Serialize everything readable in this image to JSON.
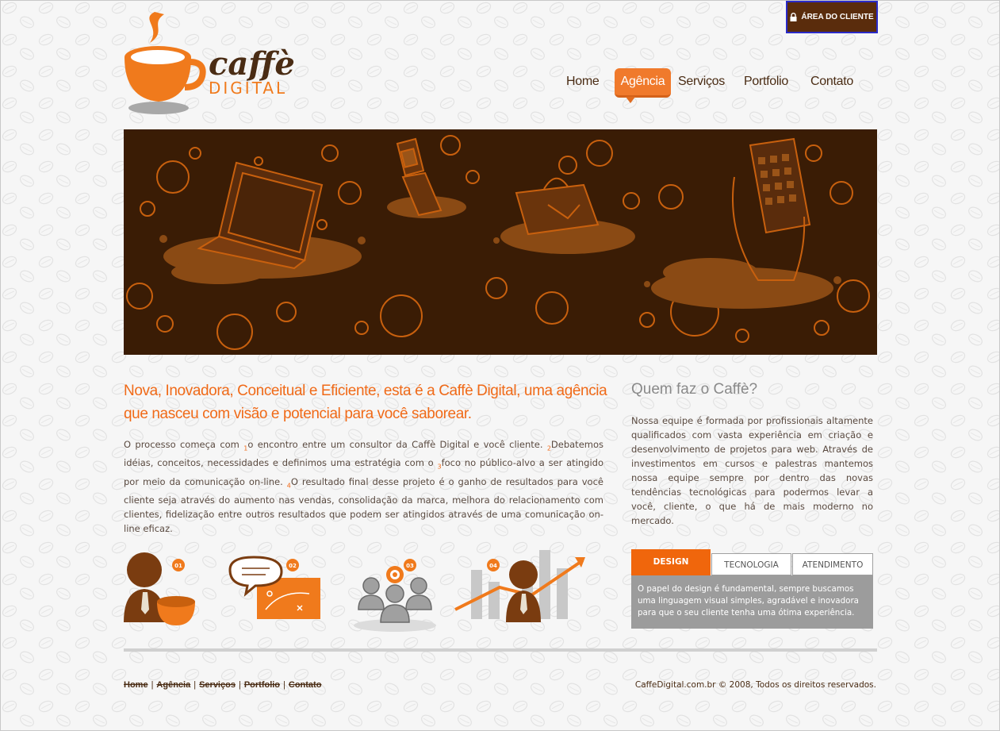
{
  "header": {
    "logo_word1": "caffè",
    "logo_word2": "DIGITAL",
    "client_area": "ÁREA DO CLIENTE"
  },
  "nav": {
    "items": [
      {
        "label": "Home",
        "active": false
      },
      {
        "label": "Agência",
        "active": true
      },
      {
        "label": "Serviços",
        "active": false
      },
      {
        "label": "Portfolio",
        "active": false
      },
      {
        "label": "Contato",
        "active": false
      }
    ]
  },
  "main": {
    "headline": "Nova, Inovadora, Conceitual e Eficiente, esta é a Caffè Digital, uma agência que nasceu com visão e potencial para você saborear.",
    "intro": {
      "p1": "O processo começa com ",
      "n1": "1",
      "p2": "o encontro entre um consultor da Caffè Digital e você cliente. ",
      "n2": "2",
      "p3": "Debatemos idéias, conceitos, necessidades e definimos uma estratégia com o ",
      "n3": "3",
      "p4": "foco no público-alvo a ser atingido por meio da comunicação on-line. ",
      "n4": "4",
      "p5": "O resultado final desse projeto é o ganho de resultados para você cliente seja através do aumento nas vendas, consolidação da marca, melhora do relacionamento com clientes, fidelização entre outros resultados que podem ser atingidos através de uma comunicação on-line eficaz."
    },
    "steps": [
      "01",
      "02",
      "03",
      "04"
    ]
  },
  "sidebar": {
    "title": "Quem faz o Caffè?",
    "text": "Nossa equipe é formada por profissionais altamente qualificados com vasta experiência em criação e desenvolvimento de projetos para web. Através de investimentos em cursos e palestras mantemos nossa equipe sempre por dentro das novas tendências tecnológicas para podermos levar a você, cliente, o que há de mais moderno no mercado.",
    "tabs": [
      {
        "label": "DESIGN",
        "active": true
      },
      {
        "label": "TECNOLOGIA",
        "active": false
      },
      {
        "label": "ATENDIMENTO",
        "active": false
      }
    ],
    "tab_content": "O papel do design é fundamental, sempre buscamos uma linguagem visual simples, agradável e inovadora para que o seu cliente tenha uma ótima experiência."
  },
  "footer": {
    "links": [
      "Home",
      "Agência",
      "Serviços",
      "Portfolio",
      "Contato"
    ],
    "copyright": "CaffeDigital.com.br © 2008, Todos os direitos reservados."
  },
  "colors": {
    "brand_orange": "#f07a2c",
    "brand_brown": "#3a1c05",
    "text_brown": "#4a2c14"
  }
}
